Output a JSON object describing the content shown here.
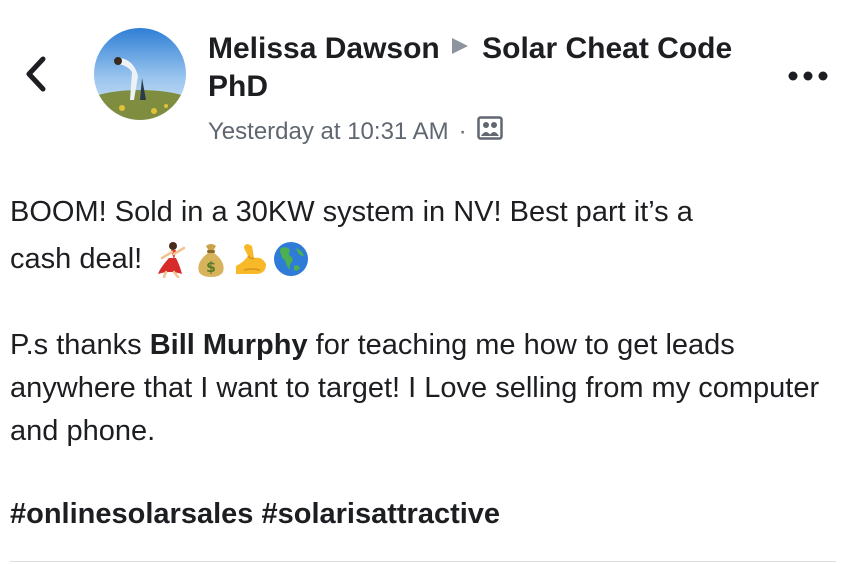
{
  "header": {
    "author": "Melissa Dawson",
    "separator": "▶",
    "group": "Solar Cheat Code PhD",
    "timestamp": "Yesterday at 10:31 AM",
    "meta_separator": "·",
    "audience_icon": "group-audience-icon"
  },
  "post": {
    "line1": "BOOM! Sold in a 30KW system in NV! Best part it’s a",
    "line2": "cash deal!",
    "emojis": [
      "dancer-emoji",
      "money-bag-emoji",
      "flexed-biceps-emoji",
      "globe-americas-emoji"
    ],
    "para2_before": "P.s thanks ",
    "mention": "Bill Murphy",
    "para2_after": " for teaching me how to get leads anywhere that I want to target! I Love selling from my computer and phone.",
    "hashtags": [
      "#onlinesolarsales",
      "#solarisattractive"
    ]
  },
  "colors": {
    "text": "#1c1e21",
    "secondary": "#606770",
    "divider": "#dadde1"
  }
}
